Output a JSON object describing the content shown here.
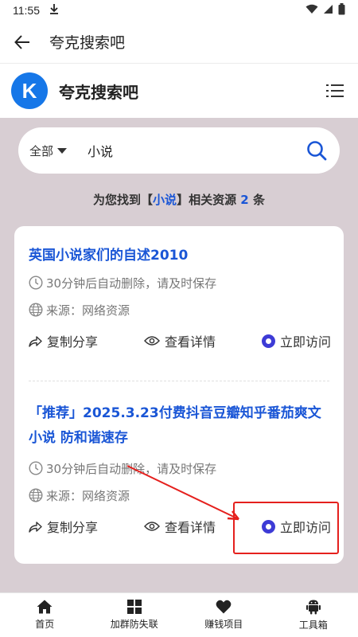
{
  "status": {
    "time": "11:55"
  },
  "appbar": {
    "title": "夸克搜索吧"
  },
  "site": {
    "logo_letter": "K",
    "title": "夸克搜索吧"
  },
  "search": {
    "scope": "全部",
    "query": "小说"
  },
  "result_info": {
    "prefix": "为您找到【",
    "keyword": "小说",
    "middle": "】相关资源 ",
    "count": "2",
    "suffix": " 条"
  },
  "results": [
    {
      "title": "英国小说家们的自述2010",
      "expire": "30分钟后自动删除，请及时保存",
      "source": "来源：网络资源",
      "copy_label": "复制分享",
      "detail_label": "查看详情",
      "visit_label": "立即访问"
    },
    {
      "title": "「推荐」2025.3.23付费抖音豆瓣知乎番茄爽文小说 防和谐速存",
      "expire": "30分钟后自动删除，请及时保存",
      "source": "来源：网络资源",
      "copy_label": "复制分享",
      "detail_label": "查看详情",
      "visit_label": "立即访问"
    }
  ],
  "nav": {
    "items": [
      {
        "label": "首页",
        "icon": "home-icon"
      },
      {
        "label": "加群防失联",
        "icon": "grid-icon"
      },
      {
        "label": "赚钱项目",
        "icon": "heart-icon"
      },
      {
        "label": "工具箱",
        "icon": "android-icon"
      }
    ]
  },
  "colors": {
    "accent": "#1a56d6",
    "logo": "#1677e8",
    "background": "#d8ced3",
    "annotation": "#e5201d"
  }
}
